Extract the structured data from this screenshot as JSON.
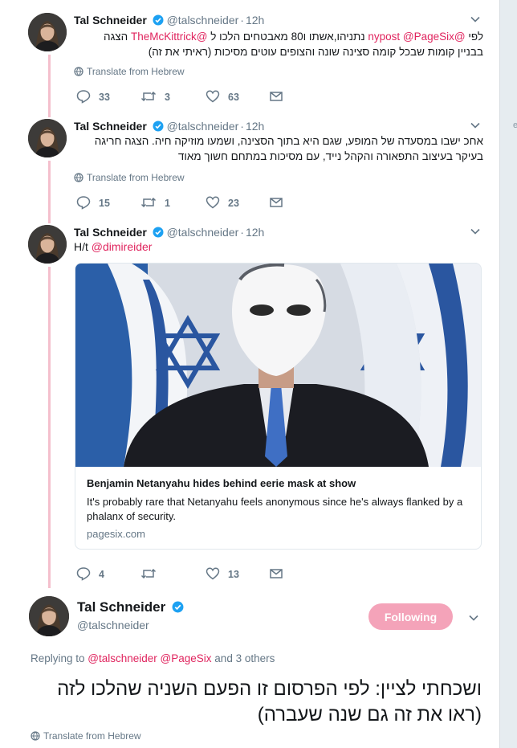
{
  "colors": {
    "accent": "#e0245e",
    "thread_line": "#f4c0cd",
    "follow_button": "#f4a3b9",
    "verified": "#1da1f2",
    "muted": "#657786"
  },
  "tweets": [
    {
      "name": "Tal Schneider",
      "handle": "@talschneider",
      "time": "12h",
      "text_lines": [
        [
          {
            "t": "לפי "
          },
          {
            "t": "@nypost @PageSix",
            "m": true
          },
          {
            "t": " נתניהו,אשתו ו80 מאבטחים הלכו ל "
          },
          {
            "t": "@TheMcKittrick",
            "m": true
          },
          {
            "t": " הצגה"
          }
        ],
        [
          {
            "t": "בבניין קומות שבכל קומה סצינה שונה והצופים עוטים מסיכות (ראיתי את זה)"
          }
        ]
      ],
      "translate_label": "Translate from Hebrew",
      "replies": "33",
      "retweets": "3",
      "likes": "63"
    },
    {
      "name": "Tal Schneider",
      "handle": "@talschneider",
      "time": "12h",
      "text_lines": [
        [
          {
            "t": "אחכ ישבו במסעדה של המופע, שגם היא בתוך הסצינה, ושמעו מוזיקה חיה. הצגה חריגה"
          }
        ],
        [
          {
            "t": "בעיקר בעיצוב התפאורה והקהל נייד, עם מסיכות  במתחם חשוך מאוד"
          }
        ]
      ],
      "translate_label": "Translate from Hebrew",
      "replies": "15",
      "retweets": "1",
      "likes": "23"
    },
    {
      "name": "Tal Schneider",
      "handle": "@talschneider",
      "time": "12h",
      "ht_prefix": "H/t ",
      "ht_mention": "@dimireider",
      "card": {
        "title": "Benjamin Netanyahu hides behind eerie mask at show",
        "description": "It's probably rare that Netanyahu feels anonymous since he's always flanked by a phalanx of security.",
        "domain": "pagesix.com"
      },
      "replies": "4",
      "retweets": "",
      "likes": "13"
    }
  ],
  "main_tweet": {
    "name": "Tal Schneider",
    "handle": "@talschneider",
    "follow_label": "Following",
    "replying_prefix": "Replying to ",
    "replying_mentions": "@talschneider @PageSix",
    "replying_suffix": " and 3 others",
    "text": "ושכחתי לציין: לפי הפרסום זו הפעם השניה שהלכו לזה (ראו את זה גם שנה שעברה)",
    "translate_label": "Translate from Hebrew"
  },
  "side_marker": "e"
}
